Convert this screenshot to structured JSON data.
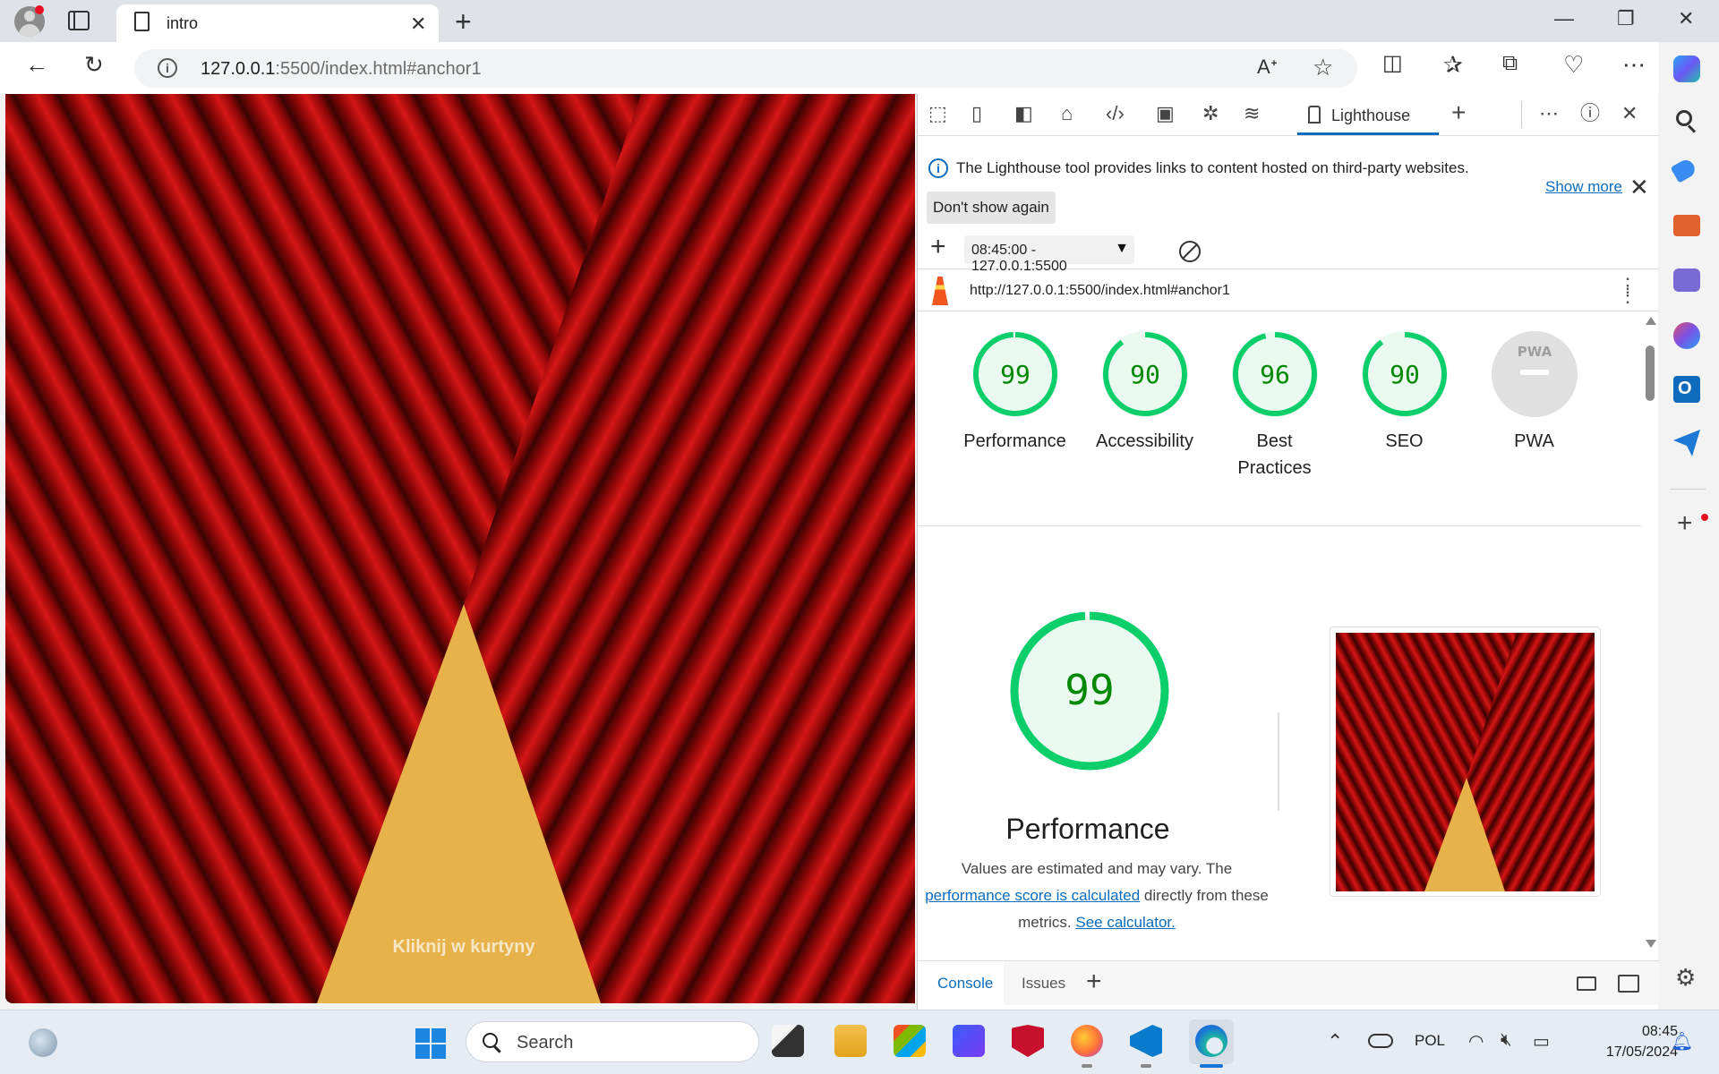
{
  "browser": {
    "tab_title": "intro",
    "url_host": "127.0.0.1",
    "url_rest": ":5500/index.html#anchor1"
  },
  "page": {
    "curtain_text": "Kliknij w kurtyny"
  },
  "devtools": {
    "active_tab": "Lighthouse",
    "info_message": "The Lighthouse tool provides links to content hosted on third-party websites.",
    "show_more": "Show more",
    "dont_show_again": "Don't show again",
    "report_select": "08:45:00 - 127.0.0.1:5500",
    "report_url": "http://127.0.0.1:5500/index.html#anchor1",
    "scores": [
      {
        "label": "Performance",
        "value": 99,
        "color": "#0cce6b"
      },
      {
        "label": "Accessibility",
        "value": 90,
        "color": "#0cce6b"
      },
      {
        "label": "Best Practices",
        "value": 96,
        "color": "#0cce6b"
      },
      {
        "label": "SEO",
        "value": 90,
        "color": "#0cce6b"
      },
      {
        "label": "PWA",
        "value": null,
        "badge": "PWA",
        "color": "#cccccc"
      }
    ],
    "performance": {
      "score": 99,
      "title": "Performance",
      "desc_pre": "Values are estimated and may vary. The ",
      "desc_link1": "performance score is calculated",
      "desc_mid": " directly from these metrics. ",
      "desc_link2": "See calculator."
    },
    "drawer": {
      "console": "Console",
      "issues": "Issues"
    }
  },
  "taskbar": {
    "search_placeholder": "Search",
    "language": "POL",
    "time": "08:45",
    "date": "17/05/2024"
  }
}
